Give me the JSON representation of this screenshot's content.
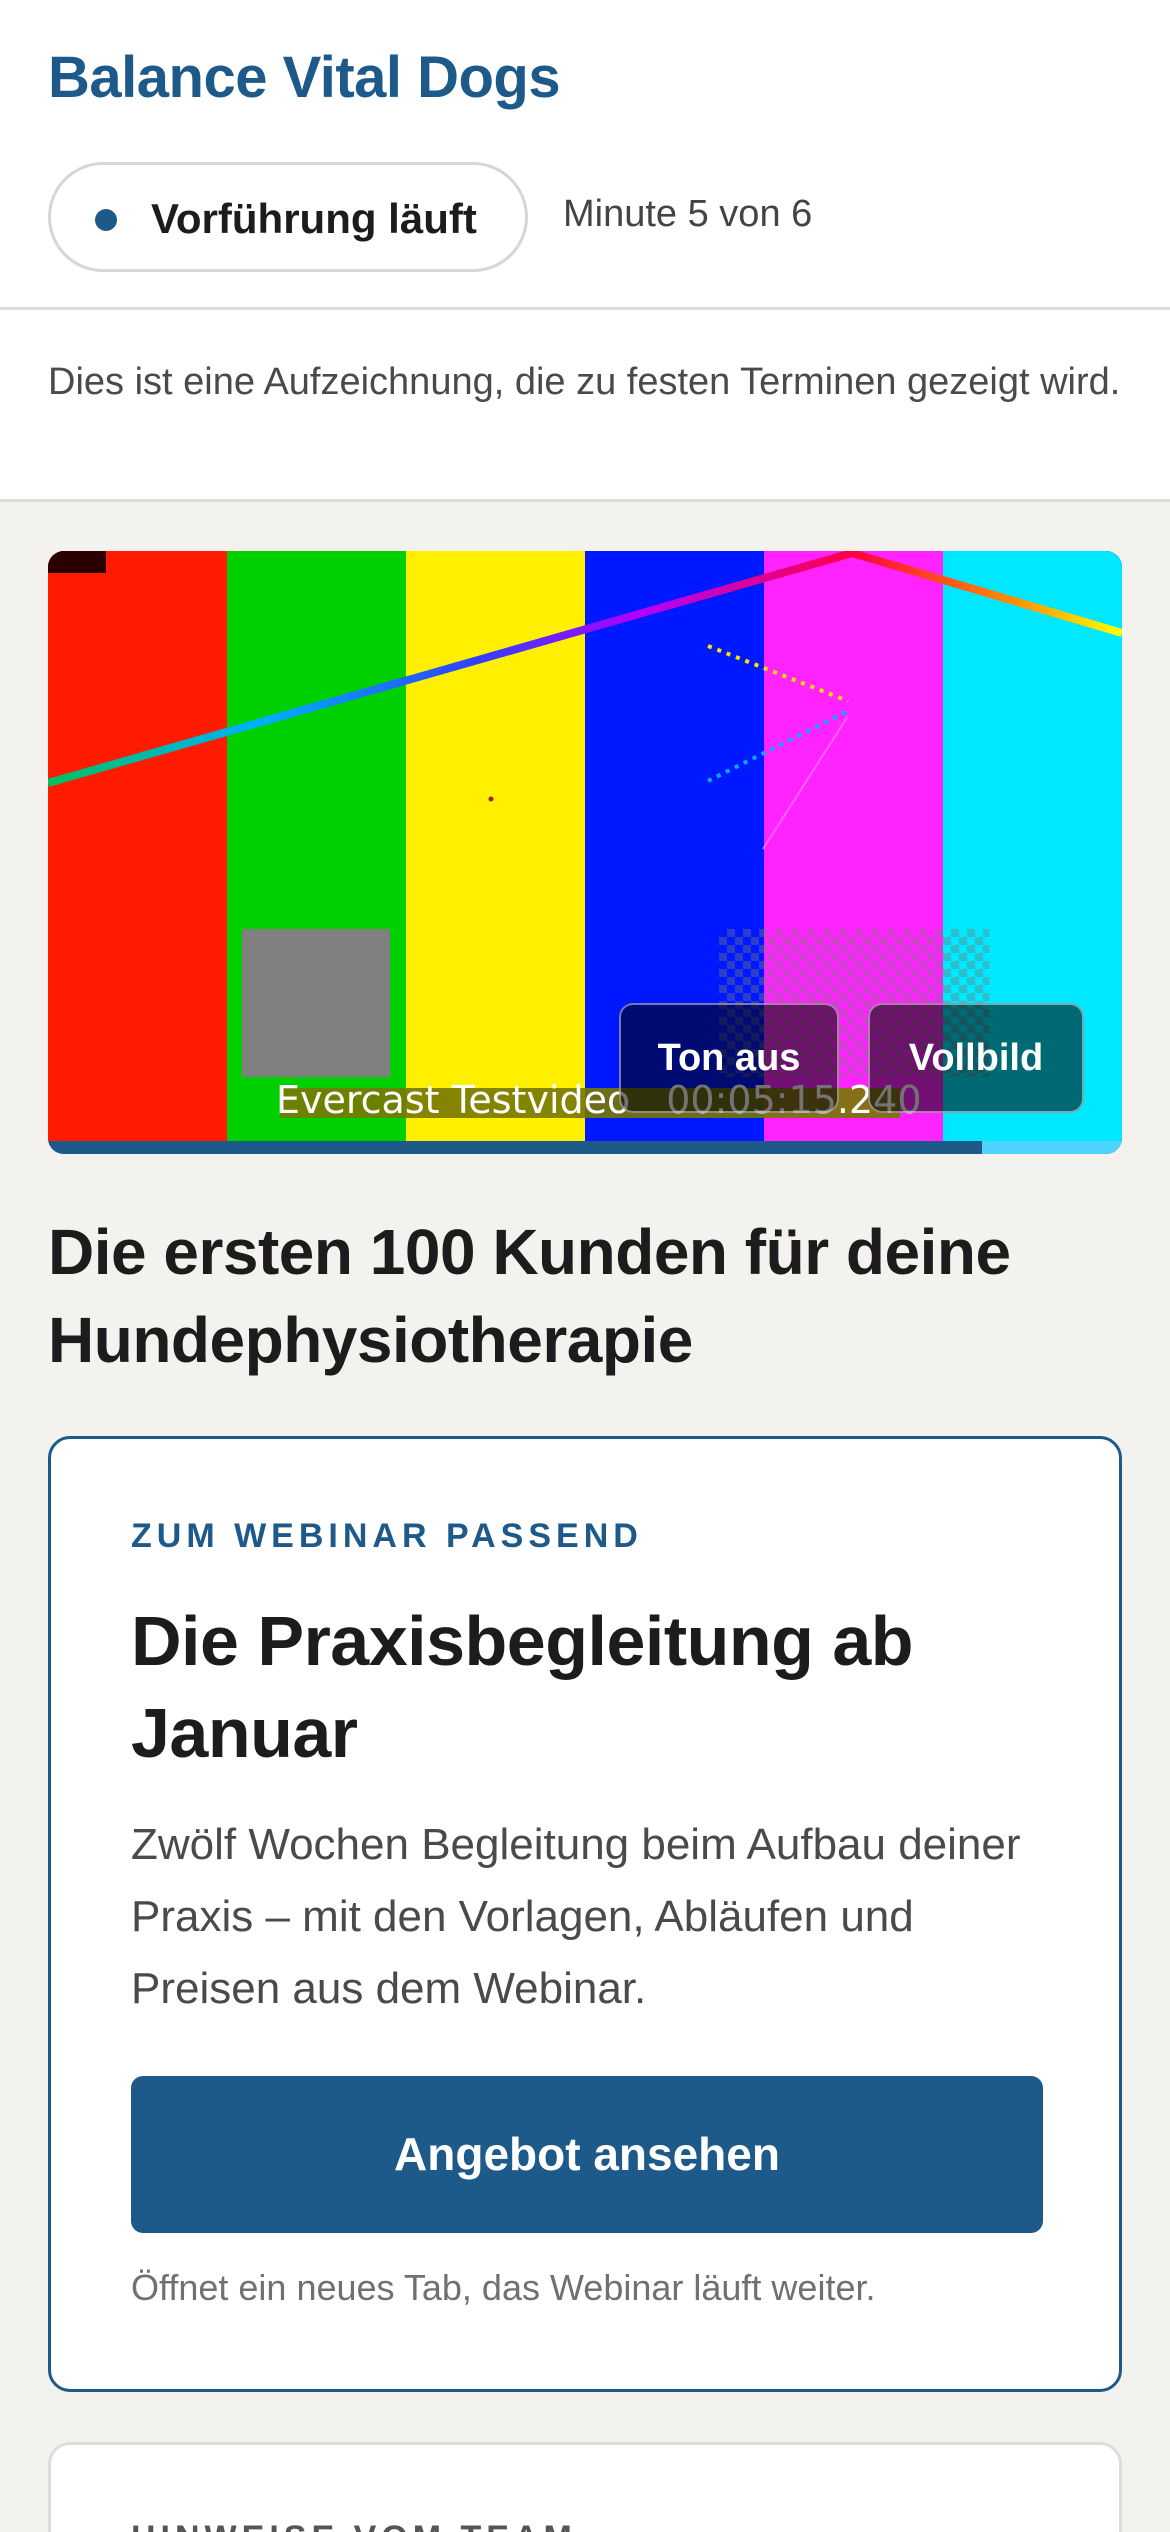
{
  "header": {
    "brand": "Balance Vital Dogs",
    "live_label": "Vorführung läuft",
    "minute_text": "Minute 5 von 6",
    "accent_color": "#1d5a8a"
  },
  "notice": {
    "text": "Dies ist eine Aufzeichnung, die zu festen Terminen gezeigt wird."
  },
  "player": {
    "caption_title": "Evercast Testvideo",
    "caption_time": "00:05:15.240",
    "mute_label": "Ton aus",
    "fullscreen_label": "Vollbild",
    "progress_fraction": 0.87,
    "bar_colors": [
      "#ff1a00",
      "#00d000",
      "#fff000",
      "#0018ff",
      "#ff24ff",
      "#00e8ff"
    ]
  },
  "webinar": {
    "title": "Die ersten 100 Kunden für deine Hundephysiotherapie"
  },
  "offer": {
    "eyebrow": "ZUM WEBINAR PASSEND",
    "title": "Die Praxisbegleitung ab Januar",
    "description": "Zwölf Wochen Begleitung beim Aufbau deiner Praxis – mit den Vorlagen, Abläufen und Preisen aus dem Webinar.",
    "cta_label": "Angebot ansehen",
    "cta_note": "Öffnet ein neues Tab, das Webinar läuft weiter."
  },
  "next_card": {
    "eyebrow": "HINWEISE VOM TEAM"
  }
}
